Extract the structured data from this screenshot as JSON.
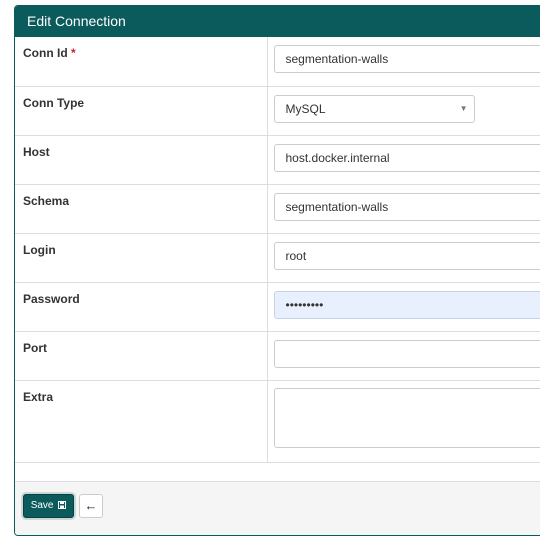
{
  "header": {
    "title": "Edit Connection"
  },
  "fields": {
    "conn_id": {
      "label": "Conn Id",
      "required_mark": "*",
      "value": "segmentation-walls"
    },
    "conn_type": {
      "label": "Conn Type",
      "value": "MySQL"
    },
    "host": {
      "label": "Host",
      "value": "host.docker.internal"
    },
    "schema": {
      "label": "Schema",
      "value": "segmentation-walls"
    },
    "login": {
      "label": "Login",
      "value": "root"
    },
    "password": {
      "label": "Password",
      "value": "•••••••••"
    },
    "port": {
      "label": "Port",
      "value": ""
    },
    "extra": {
      "label": "Extra",
      "value": ""
    }
  },
  "footer": {
    "save_label": "Save",
    "save_icon": "floppy-disk-icon",
    "back_icon": "arrow-left-icon"
  },
  "colors": {
    "accent": "#0b5a5c",
    "autofill_bg": "#e8f0fe",
    "required": "#cc2222"
  }
}
